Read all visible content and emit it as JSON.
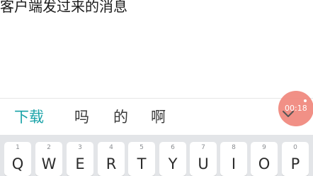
{
  "message": {
    "text": "客户端发过来的消息"
  },
  "candidates": [
    {
      "label": "下载",
      "highlighted": true
    },
    {
      "label": "吗",
      "highlighted": false
    },
    {
      "label": "的",
      "highlighted": false
    },
    {
      "label": "啊",
      "highlighted": false
    }
  ],
  "timer": {
    "text": "00:18",
    "color": "#f08a80"
  },
  "keyboard": {
    "keys": [
      {
        "num": "1",
        "letter": "Q"
      },
      {
        "num": "2",
        "letter": "W"
      },
      {
        "num": "3",
        "letter": "E"
      },
      {
        "num": "4",
        "letter": "R"
      },
      {
        "num": "5",
        "letter": "T"
      },
      {
        "num": "6",
        "letter": "Y"
      },
      {
        "num": "7",
        "letter": "U"
      },
      {
        "num": "8",
        "letter": "I"
      },
      {
        "num": "9",
        "letter": "O"
      },
      {
        "num": "0",
        "letter": "P"
      }
    ]
  },
  "colors": {
    "accent": "#1aa3a8",
    "keyboard_bg": "#e3e5e8"
  }
}
